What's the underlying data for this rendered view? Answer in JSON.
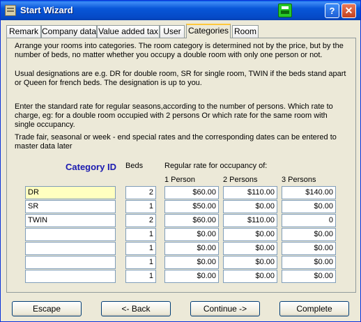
{
  "window": {
    "title": "Start Wizard",
    "help_glyph": "?",
    "close_glyph": "✕",
    "print_icon": "print-icon"
  },
  "tabs": [
    {
      "label": "Remark",
      "active": false
    },
    {
      "label": "Company data",
      "active": false
    },
    {
      "label": "Value added tax",
      "active": false
    },
    {
      "label": "User",
      "active": false
    },
    {
      "label": "Categories",
      "active": true
    },
    {
      "label": "Room",
      "active": false
    }
  ],
  "intro": {
    "p1": "Arrange your rooms into categories. The room category is determined not by the price, but by the number of beds, no matter whether you occupy a double room with only one person or not.",
    "p2": "Usual designations are e.g. DR for double room, SR for single room, TWIN if the beds stand apart or Queen for french beds. The designation is up to you.",
    "p3": "Enter the standard rate for regular seasons,according to the number of persons. Which rate to charge, eg: for a double room occupied with 2 persons  Or which rate for the same room with single occupancy.",
    "p4": "Trade fair, seasonal or week - end special rates and the corresponding dates can be entered to master data later"
  },
  "headers": {
    "category_id": "Category ID",
    "beds": "Beds",
    "regular_rate": "Regular rate for occupancy of:",
    "p1": "1 Person",
    "p2": "2 Persons",
    "p3": "3 Persons"
  },
  "rows": [
    {
      "category": "DR",
      "beds": "2",
      "rate1": "$60.00",
      "rate2": "$110.00",
      "rate3": "$140.00"
    },
    {
      "category": "SR",
      "beds": "1",
      "rate1": "$50.00",
      "rate2": "$0.00",
      "rate3": "$0.00"
    },
    {
      "category": "TWIN",
      "beds": "2",
      "rate1": "$60.00",
      "rate2": "$110.00",
      "rate3": "0"
    },
    {
      "category": "",
      "beds": "1",
      "rate1": "$0.00",
      "rate2": "$0.00",
      "rate3": "$0.00"
    },
    {
      "category": "",
      "beds": "1",
      "rate1": "$0.00",
      "rate2": "$0.00",
      "rate3": "$0.00"
    },
    {
      "category": "",
      "beds": "1",
      "rate1": "$0.00",
      "rate2": "$0.00",
      "rate3": "$0.00"
    },
    {
      "category": "",
      "beds": "1",
      "rate1": "$0.00",
      "rate2": "$0.00",
      "rate3": "$0.00"
    }
  ],
  "buttons": {
    "escape": "Escape",
    "back": "<- Back",
    "continue": "Continue ->",
    "complete": "Complete"
  },
  "colors": {
    "title_bar": "#0856d8",
    "category_header": "#1a1ab0",
    "highlight_field": "#ffffc0",
    "active_tab_accent": "#ffc83c"
  }
}
